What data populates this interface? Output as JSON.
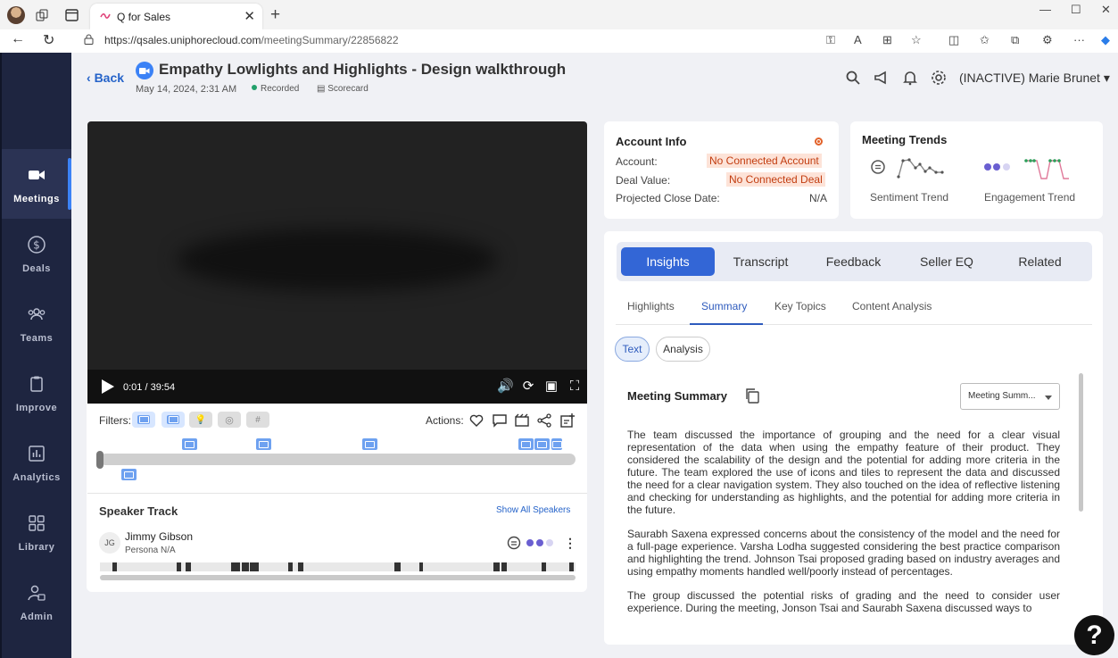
{
  "browser": {
    "tab_title": "Q for Sales",
    "url_host": "https://qsales.uniphorecloud.com",
    "url_path": "/meetingSummary/22856822"
  },
  "sidebar": {
    "items": [
      {
        "label": "Meetings",
        "icon": "video-camera-icon",
        "active": true
      },
      {
        "label": "Deals",
        "icon": "dollar-icon"
      },
      {
        "label": "Teams",
        "icon": "team-icon"
      },
      {
        "label": "Improve",
        "icon": "clipboard-icon"
      },
      {
        "label": "Analytics",
        "icon": "bar-chart-icon"
      },
      {
        "label": "Library",
        "icon": "grid-icon"
      },
      {
        "label": "Admin",
        "icon": "admin-icon"
      }
    ]
  },
  "header": {
    "back_label": "Back",
    "title": "Empathy Lowlights and Highlights - Design walkthrough",
    "date": "May 14, 2024, 2:31 AM",
    "status": "Recorded",
    "scorecard_label": "Scorecard",
    "user_name": "(INACTIVE) Marie Brunet"
  },
  "video": {
    "time": "0:01 / 39:54",
    "filters_label": "Filters:",
    "actions_label": "Actions:"
  },
  "speaker_track": {
    "title": "Speaker Track",
    "show_all": "Show All Speakers",
    "speaker": {
      "initials": "JG",
      "name": "Jimmy Gibson",
      "persona": "Persona N/A"
    }
  },
  "account_info": {
    "title": "Account Info",
    "account_label": "Account:",
    "account_value": "No Connected Account",
    "deal_label": "Deal Value:",
    "deal_value": "No Connected Deal",
    "close_label": "Projected Close Date:",
    "close_value": "N/A"
  },
  "meeting_trends": {
    "title": "Meeting Trends",
    "sentiment_label": "Sentiment Trend",
    "engagement_label": "Engagement Trend"
  },
  "insights": {
    "tabs": [
      "Insights",
      "Transcript",
      "Feedback",
      "Seller EQ",
      "Related"
    ],
    "sub_tabs": [
      "Highlights",
      "Summary",
      "Key Topics",
      "Content Analysis"
    ],
    "pills": [
      "Text",
      "Analysis"
    ],
    "summary_title": "Meeting Summary",
    "select_value": "Meeting Summ...",
    "paragraphs": [
      "The team discussed the importance of grouping and the need for a clear visual representation of the data when using the empathy feature of their product. They considered the scalability of the design and the potential for adding more criteria in the future. The team explored the use of icons and tiles to represent the data and discussed the need for a clear navigation system. They also touched on the idea of reflective listening and checking for understanding as highlights, and the potential for adding more criteria in the future.",
      "Saurabh Saxena expressed concerns about the consistency of the model and the need for a full-page experience. Varsha Lodha suggested considering the best practice comparison and highlighting the trend. Johnson Tsai proposed grading based on industry averages and using empathy moments handled well/poorly instead of percentages.",
      "The group discussed the potential risks of grading and the need to consider user experience. During the meeting, Jonson Tsai and Saurabh Saxena discussed ways to"
    ]
  },
  "help_label": "?",
  "colors": {
    "accent": "#3366d6",
    "sidebar": "#1e2540",
    "warn_bg": "#fde3d8",
    "warn_text": "#c23d10"
  }
}
